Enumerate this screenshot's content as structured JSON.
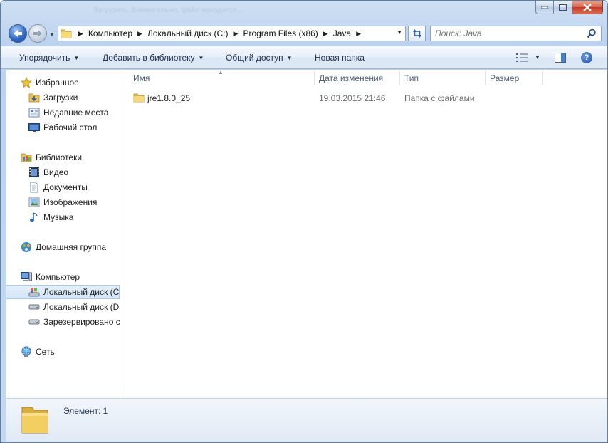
{
  "window": {
    "title_ghost": "Загрузить. Внимательно, файл находится...",
    "colors": {
      "chrome": "#c4d8f0",
      "accent": "#2d66c4",
      "close": "#c4392a"
    }
  },
  "address": {
    "crumbs": [
      "Компьютер",
      "Локальный диск (C:)",
      "Program Files (x86)",
      "Java"
    ]
  },
  "search": {
    "placeholder": "Поиск: Java"
  },
  "toolbar": {
    "organize": "Упорядочить",
    "add_library": "Добавить в библиотеку",
    "share": "Общий доступ",
    "new_folder": "Новая папка"
  },
  "nav": {
    "favorites": "Избранное",
    "downloads": "Загрузки",
    "recent": "Недавние места",
    "desktop": "Рабочий стол",
    "libraries": "Библиотеки",
    "video": "Видео",
    "documents": "Документы",
    "images": "Изображения",
    "music": "Музыка",
    "homegroup": "Домашняя группа",
    "computer": "Компьютер",
    "disk_c": "Локальный диск (C",
    "disk_d": "Локальный диск (D",
    "reserved": "Зарезервировано с",
    "network": "Сеть"
  },
  "columns": {
    "name": "Имя",
    "modified": "Дата изменения",
    "type": "Тип",
    "size": "Размер"
  },
  "files": [
    {
      "name": "jre1.8.0_25",
      "modified": "19.03.2015 21:46",
      "type": "Папка с файлами",
      "size": ""
    }
  ],
  "status": {
    "text": "Элемент: 1"
  }
}
